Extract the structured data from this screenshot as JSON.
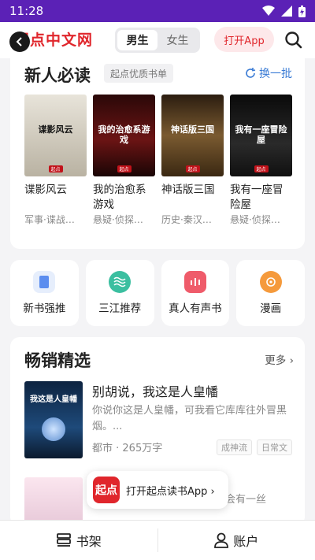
{
  "status": {
    "time": "11:28"
  },
  "header": {
    "logo": "起点中文网",
    "gender_tabs": [
      "男生",
      "女生"
    ],
    "open_app": "打开App"
  },
  "newbie": {
    "title": "新人必读",
    "tag": "起点优质书单",
    "refresh": "换一批",
    "books": [
      {
        "title": "谍影风云",
        "sub": "军事·谍战…",
        "cover_text": "谍影风云",
        "color": "#c9c4b8"
      },
      {
        "title": "我的治愈系游戏",
        "sub": "悬疑·侦探…",
        "cover_text": "我的治愈系游戏",
        "color": "#3a0d0d"
      },
      {
        "title": "神话版三国",
        "sub": "历史·秦汉…",
        "cover_text": "神话版三国",
        "color": "#4a3520"
      },
      {
        "title": "我有一座冒险屋",
        "sub": "悬疑·侦探…",
        "cover_text": "我有一座冒险屋",
        "color": "#1a1a1a"
      }
    ]
  },
  "quick_links": [
    {
      "label": "新书强推",
      "color": "#5b8def"
    },
    {
      "label": "三江推荐",
      "color": "#3bbfa0"
    },
    {
      "label": "真人有声书",
      "color": "#ef5b6a"
    },
    {
      "label": "漫画",
      "color": "#f59a3c"
    }
  ],
  "bestseller": {
    "title": "畅销精选",
    "more": "更多",
    "book": {
      "title": "别胡说，我这是人皇幡",
      "desc": "你说你这是人皇幡，可我看它库库往外冒黑烟。...",
      "meta": "都市 · 265万字",
      "tags": [
        "成神流",
        "日常文"
      ],
      "cover_text": "我这是人皇幡"
    },
    "book2_partial": "金上人讨境，年少万与贾家不会有一丝"
  },
  "banner": {
    "logo": "起点",
    "text": "打开起点读书App ›"
  },
  "bottom_nav": {
    "shelf": "书架",
    "account": "账户"
  }
}
